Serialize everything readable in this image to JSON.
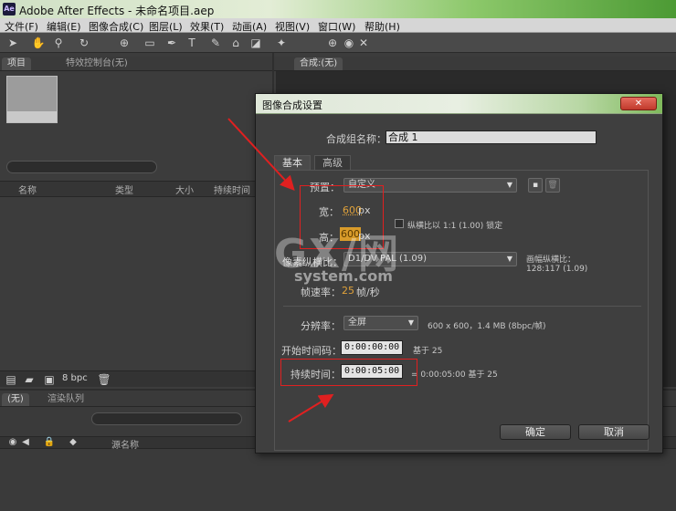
{
  "window": {
    "app_icon": "Ae",
    "title": "Adobe After Effects - 未命名项目.aep"
  },
  "menubar": {
    "items": [
      "文件(F)",
      "编辑(E)",
      "图像合成(C)",
      "图层(L)",
      "效果(T)",
      "动画(A)",
      "视图(V)",
      "窗口(W)",
      "帮助(H)"
    ]
  },
  "panels": {
    "project_tab": "项目",
    "effects_tab": "特效控制台(无)",
    "comp_tab": "合成:(无)",
    "project_columns": [
      "名称",
      "类型",
      "大小",
      "持续时间"
    ],
    "bpc": "8 bpc",
    "timeline_tab": "(无)",
    "render_tab": "渲染队列",
    "timeline_col_name": "源名称"
  },
  "dialog": {
    "title": "图像合成设置",
    "close_label": "✕",
    "comp_name_label": "合成组名称：",
    "comp_name_value": "合成 1",
    "tabs": [
      "基本",
      "高级"
    ],
    "preset_label": "预置：",
    "preset_value": "自定义",
    "width_label": "宽：",
    "width_value": "600",
    "width_unit": "px",
    "height_label": "高：",
    "height_value": "600",
    "height_unit": "px",
    "lock_aspect_label": "纵横比以 1:1 (1.00) 锁定",
    "par_label": "像素纵横比：",
    "par_value": "D1/DV PAL (1.09)",
    "frame_aspect_label": "画幅纵横比：",
    "frame_aspect_value": "128:117 (1.09)",
    "fps_label": "帧速率：",
    "fps_value": "25",
    "fps_unit": "帧/秒",
    "resolution_label": "分辨率：",
    "resolution_value": "全屏",
    "resolution_info": "600 x 600，1.4 MB (8bpc/帧)",
    "start_tc_label": "开始时间码：",
    "start_tc_value": "0:00:00:00",
    "start_tc_base": "基于 25",
    "duration_label": "持续时间：",
    "duration_value": "0:00:05:00",
    "duration_info": "= 0:00:05:00  基于 25",
    "ok_label": "确定",
    "cancel_label": "取消"
  },
  "watermark": {
    "main": "GX/网",
    "sub": "system.com"
  },
  "colors": {
    "annotation_red": "#e02020",
    "value_orange": "#e0a23a"
  }
}
